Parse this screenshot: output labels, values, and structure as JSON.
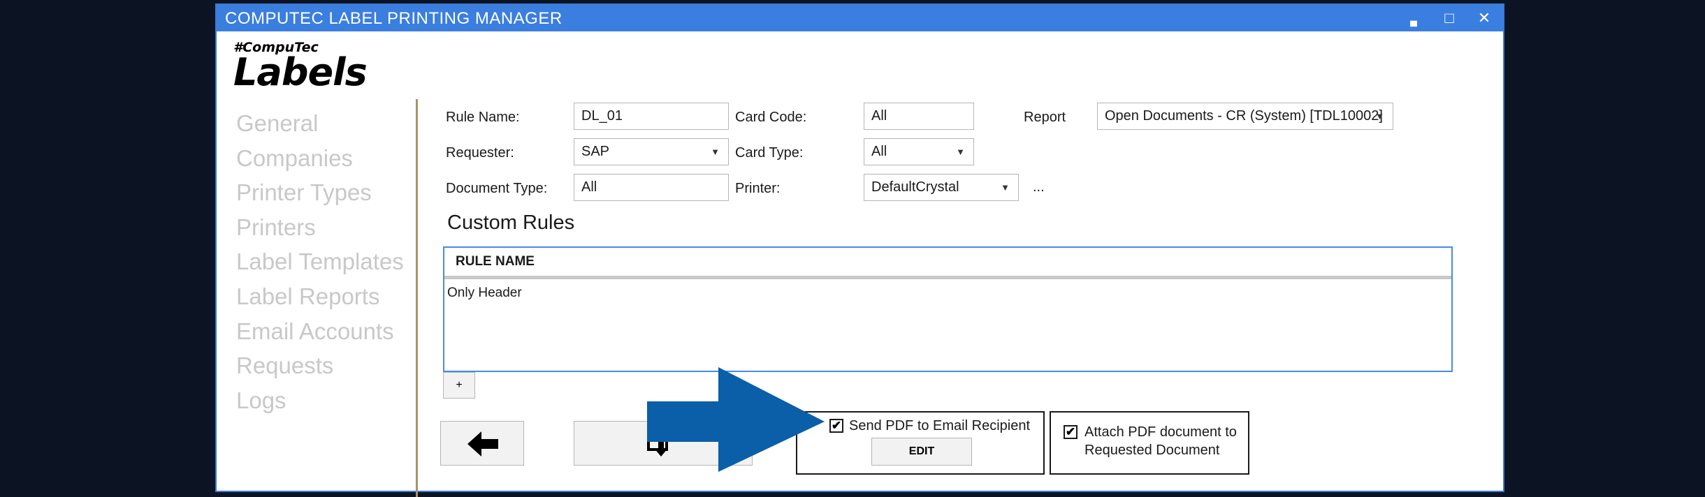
{
  "window": {
    "title": "COMPUTEC LABEL PRINTING MANAGER",
    "minimize_glyph": "▄",
    "maximize_glyph": "□",
    "close_glyph": "✕"
  },
  "logo": {
    "brand": "#CompuTec",
    "name": "Labels"
  },
  "sidebar": {
    "items": [
      {
        "label": "General"
      },
      {
        "label": "Companies"
      },
      {
        "label": "Printer Types"
      },
      {
        "label": "Printers"
      },
      {
        "label": "Label Templates"
      },
      {
        "label": "Label Reports"
      },
      {
        "label": "Email Accounts"
      },
      {
        "label": "Requests"
      },
      {
        "label": "Logs"
      }
    ]
  },
  "form": {
    "rule_name_label": "Rule Name:",
    "rule_name_value": "DL_01",
    "card_code_label": "Card Code:",
    "card_code_value": "All",
    "report_label": "Report",
    "report_value": "Open Documents - CR (System)  [TDL10002]",
    "requester_label": "Requester:",
    "requester_value": "SAP",
    "card_type_label": "Card Type:",
    "card_type_value": "All",
    "document_type_label": "Document Type:",
    "document_type_value": "All",
    "printer_label": "Printer:",
    "printer_value": "DefaultCrystal",
    "printer_more": "...",
    "dropdown_arrow": "▼"
  },
  "custom_rules": {
    "title": "Custom Rules",
    "column_header": "RULE NAME",
    "rows": [
      "Only Header"
    ],
    "add_label": "+"
  },
  "footer": {
    "back_icon": "←",
    "send_pdf_label": "Send PDF to Email Recipient",
    "send_pdf_checked": true,
    "edit_label": "EDIT",
    "attach_pdf_label_line1": "Attach PDF document to",
    "attach_pdf_label_line2": "Requested Document",
    "attach_pdf_checked": true,
    "check_glyph": "✔"
  },
  "colors": {
    "titlebar": "#3a7ee0",
    "arrow": "#0a5fa8",
    "divider": "#a8926a",
    "nav_text": "#c8c8c8"
  }
}
